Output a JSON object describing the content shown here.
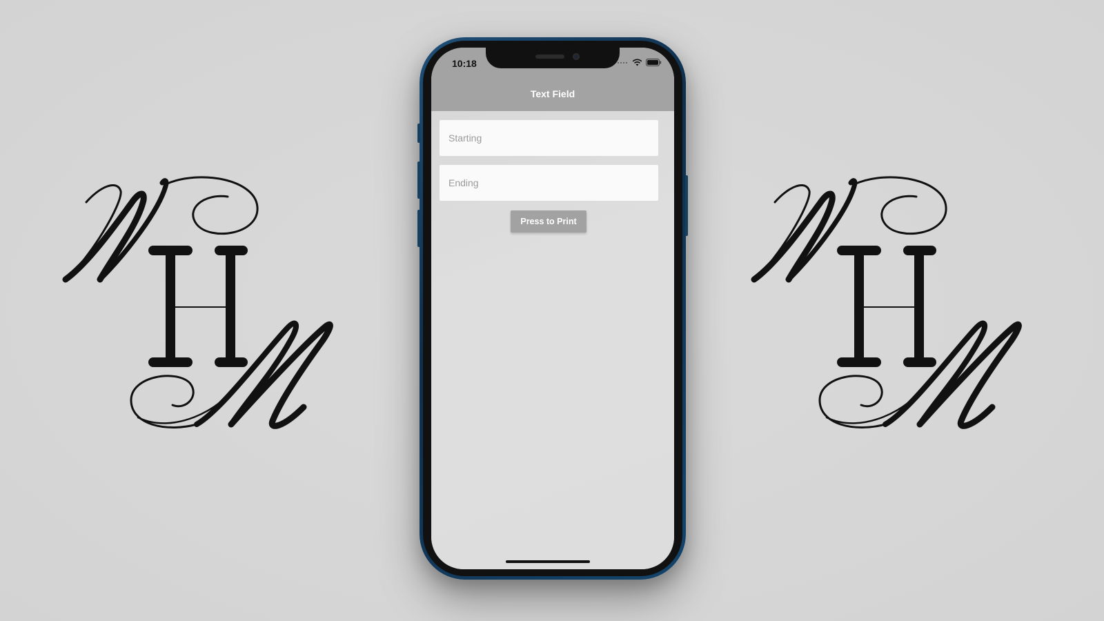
{
  "status_bar": {
    "time": "10:18",
    "signal_icon": "signal-dots-icon",
    "wifi_icon": "wifi-icon",
    "battery_icon": "battery-icon"
  },
  "nav": {
    "title": "Text Field"
  },
  "form": {
    "starting": {
      "placeholder": "Starting",
      "value": ""
    },
    "ending": {
      "placeholder": "Ending",
      "value": ""
    },
    "print_button_label": "Press to Print"
  },
  "decor": {
    "logo_text": "WHM",
    "logo_icon": "whm-monogram-logo"
  },
  "colors": {
    "background": "#d6d6d6",
    "navbar": "#a3a3a3",
    "button": "#a2a2a2",
    "phone_frame": "#1f4f78"
  }
}
